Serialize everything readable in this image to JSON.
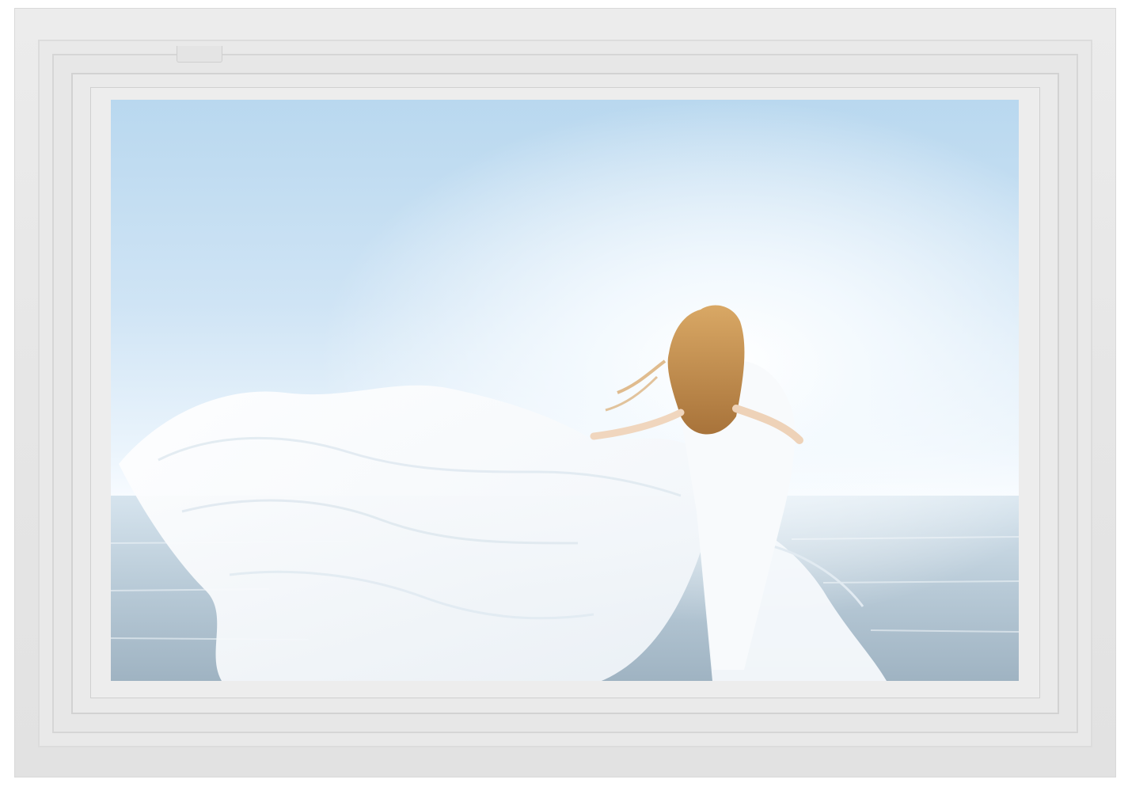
{
  "product": {
    "type": "digital-photo-frame",
    "frame_color": "#e8e8e8",
    "screen_content": "photo"
  },
  "colors": {
    "sky_top": "#b9d8ef",
    "sky_glow": "#f7fbff",
    "sea": "#a8bccb",
    "dress": "#ffffff",
    "hair": "#c8914a"
  }
}
